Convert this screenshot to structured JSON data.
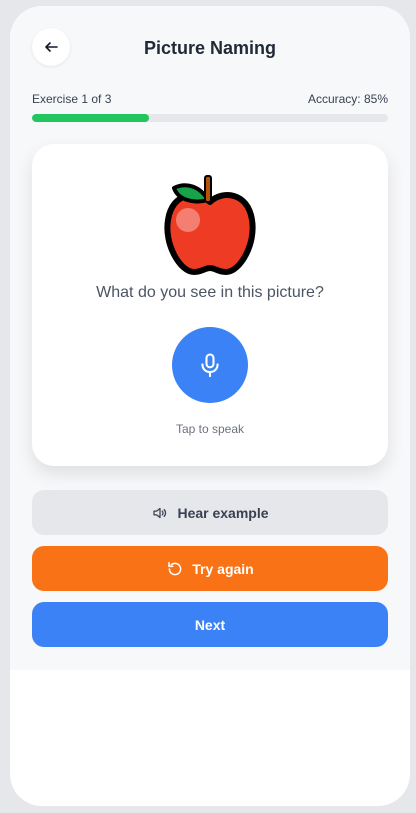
{
  "header": {
    "back_icon": "arrow-left-icon",
    "title": "Picture Naming"
  },
  "progress": {
    "exercise_label": "Exercise 1 of 3",
    "accuracy_label": "Accuracy: 85%",
    "fraction": 0.33,
    "color": "#22c55e"
  },
  "card": {
    "image_icon": "apple-icon",
    "question": "What do you see in this picture?",
    "mic_icon": "microphone-icon",
    "tap_label": "Tap to speak"
  },
  "actions": {
    "hear_label": "Hear example",
    "hear_icon": "speaker-icon",
    "retry_label": "Try again",
    "retry_icon": "rotate-ccw-icon",
    "next_label": "Next"
  },
  "colors": {
    "primary": "#3b82f6",
    "warning": "#f97316",
    "success": "#22c55e",
    "neutral": "#e5e7eb"
  }
}
